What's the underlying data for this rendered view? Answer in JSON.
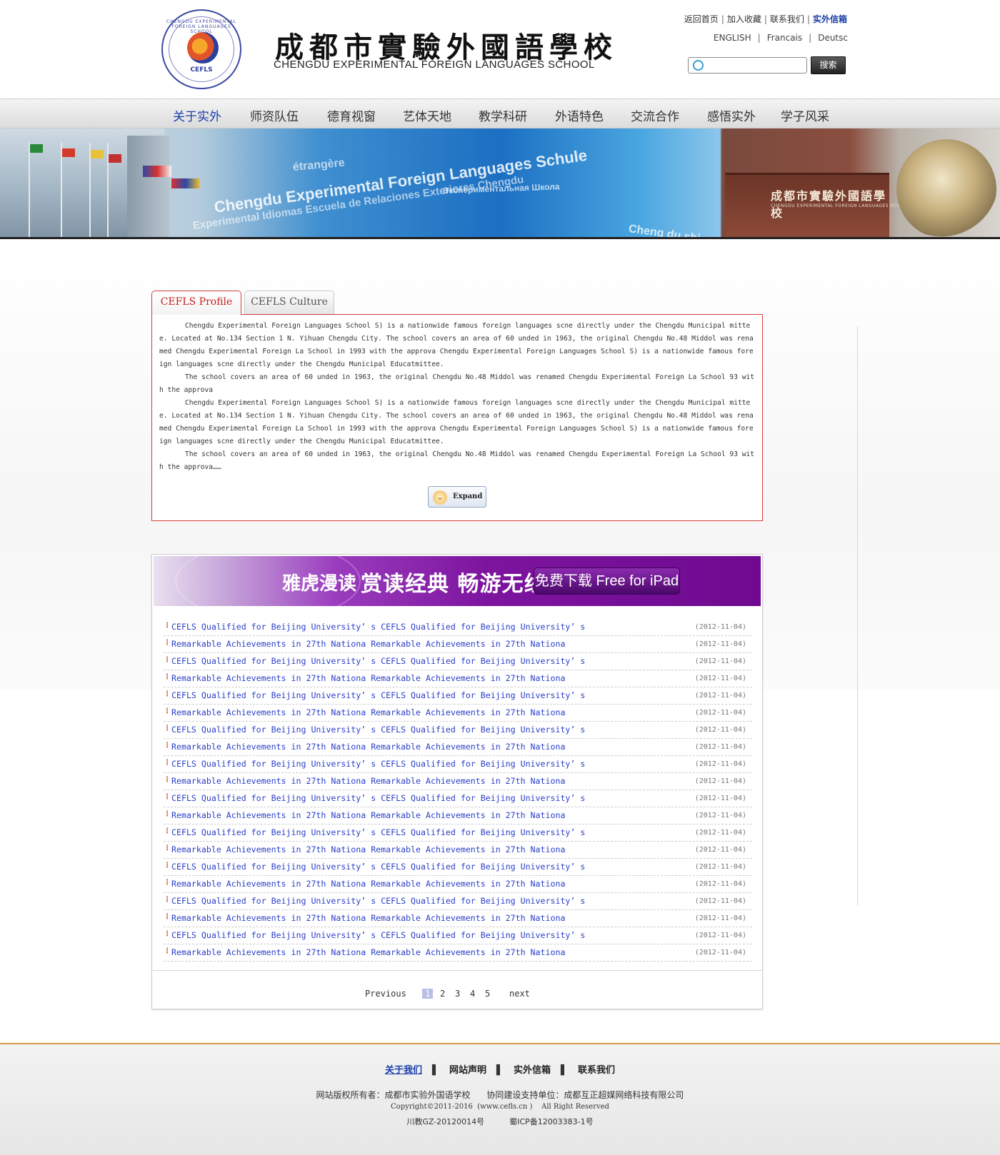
{
  "header": {
    "logo": {
      "tag": "CEFLS",
      "ring_text": "CHENGDU EXPERIMENTAL FOREIGN LANGUAGES SCHOOL"
    },
    "school_name_cn": "成都市實驗外國語學校",
    "school_name_en": "CHENGDU EXPERIMENTAL FOREIGN LANGUAGES SCHOOL",
    "top_links": [
      "返回首页",
      "加入收藏",
      "联系我们",
      "实外信箱"
    ],
    "lang_links": [
      "ENGLISH",
      "Francais",
      "Deutsc"
    ],
    "search": {
      "placeholder": "",
      "button_label": "搜索"
    }
  },
  "nav": {
    "items": [
      "关于实外",
      "师资队伍",
      "德育视窗",
      "艺体天地",
      "教学科研",
      "外语特色",
      "交流合作",
      "感悟实外",
      "学子风采"
    ],
    "active_index": 0
  },
  "banner": {
    "sign_cn": "成都市實驗外國語學校",
    "sign_en": "CHENGDU EXPERIMENTAL FOREIGN LANGUAGES SCHOOL",
    "watermark": [
      "Chengdu Experimental Foreign Languages Schule",
      "Experimental Idiomas Escuela de Relaciones Exteriores Chengdu",
      "Экспериментальная Школа",
      "étrangère",
      "Cheng du shi"
    ]
  },
  "tabs": [
    "CEFLS Profile",
    "CEFLS Culture"
  ],
  "profile": {
    "paragraphs": [
      "Chengdu Experimental Foreign Languages School S) is a nationwide famous foreign languages scne directly under the Chengdu Municipal mittee. Located at No.134 Section 1 N. Yihuan Chengdu City. The school covers an area of 60 unded in 1963, the original Chengdu No.48 Middol was renamed Chengdu Experimental Foreign La School in 1993 with the approva Chengdu Experimental Foreign Languages School S) is a nationwide famous foreign languages scne directly under the Chengdu Municipal Educatmittee.",
      "The school covers an area of 60 unded in 1963, the original Chengdu No.48 Middol was renamed Chengdu Experimental Foreign La School 93 with the approva",
      "Chengdu Experimental Foreign Languages School S) is a nationwide famous foreign languages scne directly under the Chengdu Municipal mittee. Located at No.134 Section 1 N. Yihuan Chengdu City. The school covers an area of 60 unded in 1963, the original Chengdu No.48 Middol was renamed Chengdu Experimental Foreign La School in 1993 with the approva Chengdu Experimental Foreign Languages School S) is a nationwide famous foreign languages scne directly under the Chengdu Municipal Educatmittee.",
      "The school covers an area of 60 unded in 1963, the original Chengdu No.48 Middol was renamed Chengdu Experimental Foreign La School 93 with the approva……"
    ],
    "expand_label": "Expand"
  },
  "ad": {
    "brand": "雅虎漫读",
    "slogan": "赏读经典 畅游无线",
    "download": "免费下载 Free for iPad"
  },
  "news": {
    "items": [
      {
        "title": "CEFLS Qualified for Beijing University’ s  CEFLS Qualified for Beijing University’ s",
        "date": "(2012-11-04)"
      },
      {
        "title": "Remarkable Achievements in 27th Nationa  Remarkable Achievements in 27th Nationa",
        "date": "(2012-11-04)"
      },
      {
        "title": "CEFLS Qualified for Beijing University’ s  CEFLS Qualified for Beijing University’ s",
        "date": "(2012-11-04)"
      },
      {
        "title": "Remarkable Achievements in 27th Nationa  Remarkable Achievements in 27th Nationa",
        "date": "(2012-11-04)"
      },
      {
        "title": "CEFLS Qualified for Beijing University’ s  CEFLS Qualified for Beijing University’ s",
        "date": "(2012-11-04)"
      },
      {
        "title": "Remarkable Achievements in 27th Nationa  Remarkable Achievements in 27th Nationa",
        "date": "(2012-11-04)"
      },
      {
        "title": "CEFLS Qualified for Beijing University’ s  CEFLS Qualified for Beijing University’ s",
        "date": "(2012-11-04)"
      },
      {
        "title": "Remarkable Achievements in 27th Nationa  Remarkable Achievements in 27th Nationa",
        "date": "(2012-11-04)"
      },
      {
        "title": "CEFLS Qualified for Beijing University’ s  CEFLS Qualified for Beijing University’ s",
        "date": "(2012-11-04)"
      },
      {
        "title": "Remarkable Achievements in 27th Nationa  Remarkable Achievements in 27th Nationa",
        "date": "(2012-11-04)"
      },
      {
        "title": "CEFLS Qualified for Beijing University’ s  CEFLS Qualified for Beijing University’ s",
        "date": "(2012-11-04)"
      },
      {
        "title": "Remarkable Achievements in 27th Nationa  Remarkable Achievements in 27th Nationa",
        "date": "(2012-11-04)"
      },
      {
        "title": "CEFLS Qualified for Beijing University’ s  CEFLS Qualified for Beijing University’ s",
        "date": "(2012-11-04)"
      },
      {
        "title": "Remarkable Achievements in 27th Nationa  Remarkable Achievements in 27th Nationa",
        "date": "(2012-11-04)"
      },
      {
        "title": "CEFLS Qualified for Beijing University’ s  CEFLS Qualified for Beijing University’ s",
        "date": "(2012-11-04)"
      },
      {
        "title": "Remarkable Achievements in 27th Nationa  Remarkable Achievements in 27th Nationa",
        "date": "(2012-11-04)"
      },
      {
        "title": "CEFLS Qualified for Beijing University’ s  CEFLS Qualified for Beijing University’ s",
        "date": "(2012-11-04)"
      },
      {
        "title": "Remarkable Achievements in 27th Nationa  Remarkable Achievements in 27th Nationa",
        "date": "(2012-11-04)"
      },
      {
        "title": "CEFLS Qualified for Beijing University’ s  CEFLS Qualified for Beijing University’ s",
        "date": "(2012-11-04)"
      },
      {
        "title": "Remarkable Achievements in 27th Nationa  Remarkable Achievements in 27th Nationa",
        "date": "(2012-11-04)"
      }
    ]
  },
  "pager": {
    "previous": "Previous",
    "pages": [
      "1",
      "2",
      "3",
      "4",
      "5"
    ],
    "current": "1",
    "next": "next"
  },
  "footer": {
    "links": [
      "关于我们",
      "网站声明",
      "实外信箱",
      "联系我们"
    ],
    "copyright_owner": "网站版权所有者：成都市实验外国语学校      协同建设支持单位：成都互正超媒网络科技有限公司",
    "copyright": "Copyright©2011-2016  (www.cefls.cn )    All Right Reserved",
    "icp": "川教GZ-20120014号          蜀ICP备12003383-1号"
  },
  "colors": {
    "accent_blue": "#1b3ea8",
    "link_blue": "#2a3fc8",
    "active_tab_red": "#c81e1e",
    "ad_purple": "#7d149f",
    "footer_rule": "#d49a4a"
  }
}
